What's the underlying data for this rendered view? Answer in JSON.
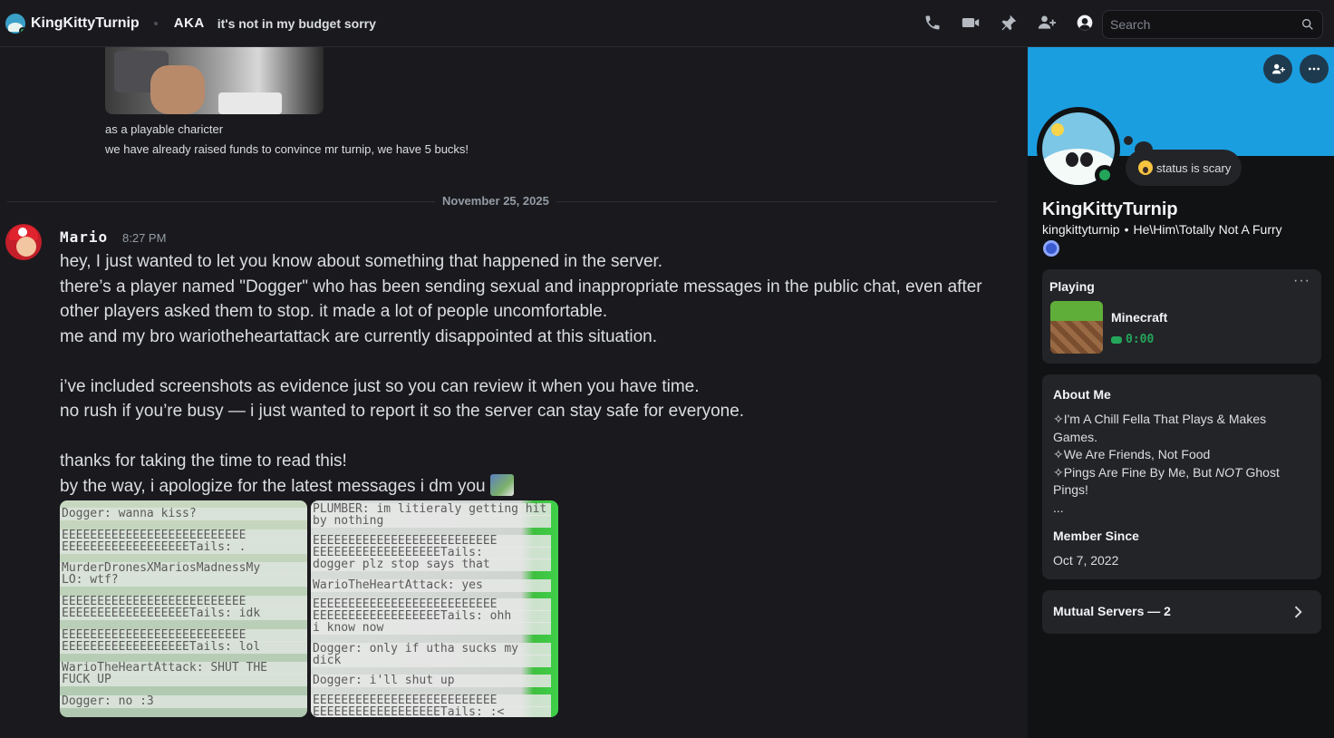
{
  "header": {
    "title": "KingKittyTurnip",
    "aka_label": "AKA",
    "aka_name": "it's not in my budget sorry",
    "search_placeholder": "Search"
  },
  "chat": {
    "previous_lines": [
      "as a playable charicter",
      "we have already raised funds to convince mr turnip, we have 5 bucks!"
    ],
    "date_divider": "November 25, 2025",
    "message": {
      "author": "Mario",
      "time": "8:27 PM",
      "lines": [
        "hey, I just wanted to let you know about something that happened in the server.",
        "there’s a player named \"Dogger\" who has been sending sexual and inappropriate messages in the public chat, even after",
        "other players asked them to stop. it made a lot of people uncomfortable.",
        "me and my bro wariotheheartattack are currently disappointed at this situation.",
        "",
        "i’ve included screenshots as evidence just so you can review it when you have time.",
        "no rush if you’re busy — i just wanted to report it so the server can stay safe for everyone.",
        "",
        "thanks for taking the time to read this!",
        "by the way, i apologize for the latest messages i dm you"
      ]
    },
    "attachment_left": [
      "Dogger: wanna kiss?",
      "EEEEEEEEEEEEEEEEEEEEEEEEEE",
      "EEEEEEEEEEEEEEEEEETails: .",
      "MurderDronesXMariosMadnessMy",
      "LO: wtf?",
      "EEEEEEEEEEEEEEEEEEEEEEEEEE",
      "EEEEEEEEEEEEEEEEEETails: idk",
      "EEEEEEEEEEEEEEEEEEEEEEEEEE",
      "EEEEEEEEEEEEEEEEEETails: lol",
      "WarioTheHeartAttack: SHUT THE",
      "FUCK UP",
      "Dogger: no :3"
    ],
    "attachment_right": [
      "PLUMBER: im litieraly getting hit",
      "by nothing",
      "EEEEEEEEEEEEEEEEEEEEEEEEEE",
      "EEEEEEEEEEEEEEEEEETails:",
      "dogger plz stop says that",
      "WarioTheHeartAttack: yes",
      "EEEEEEEEEEEEEEEEEEEEEEEEEE",
      "EEEEEEEEEEEEEEEEEETails: ohh",
      "i know now",
      "Dogger: only if utha sucks my",
      "dick",
      "Dogger: i'll shut up",
      "EEEEEEEEEEEEEEEEEEEEEEEEEE",
      "EEEEEEEEEEEEEEEEEETails: :<"
    ]
  },
  "profile": {
    "display_name": "KingKittyTurnip",
    "username": "kingkittyturnip",
    "separator": "•",
    "pronouns": "He\\Him\\Totally Not A Furry",
    "status_text": "status is scary",
    "playing_title": "Playing",
    "more_glyph": "···",
    "game_name": "Minecraft",
    "game_time": "0:00",
    "about_title": "About Me",
    "about_lines": [
      "✧I'm A Chill Fella That Plays & Makes Games.",
      "✧We Are Friends, Not Food",
      "✧Pings Are Fine By Me, But ",
      "NOT",
      " Ghost Pings!",
      "..."
    ],
    "member_since_title": "Member Since",
    "member_since_date": "Oct 7, 2022",
    "mutual_servers": "Mutual Servers — 2"
  },
  "colors": {
    "banner": "#1a9ee0",
    "online": "#23a55a",
    "background": "#1a1a1e",
    "panel": "#111214"
  },
  "icons": [
    "voice-call-icon",
    "video-call-icon",
    "pin-icon",
    "add-friends-icon",
    "user-profile-icon",
    "search-icon",
    "add-friend-icon",
    "more-icon",
    "chevron-right-icon"
  ]
}
